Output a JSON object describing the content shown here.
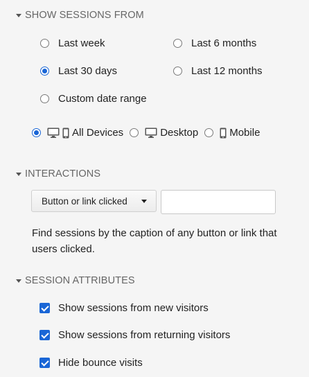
{
  "sessions_section": {
    "title": "SHOW SESSIONS FROM",
    "options": [
      {
        "label": "Last week",
        "checked": false
      },
      {
        "label": "Last 6 months",
        "checked": false
      },
      {
        "label": "Last 30 days",
        "checked": true
      },
      {
        "label": "Last 12 months",
        "checked": false
      },
      {
        "label": "Custom date range",
        "checked": false
      }
    ],
    "devices": [
      {
        "label": "All Devices",
        "checked": true
      },
      {
        "label": "Desktop",
        "checked": false
      },
      {
        "label": "Mobile",
        "checked": false
      }
    ]
  },
  "interactions_section": {
    "title": "INTERACTIONS",
    "dropdown_value": "Button or link clicked",
    "caption_input_value": "",
    "help_text": "Find sessions by the caption of any button or link that users clicked."
  },
  "attributes_section": {
    "title": "SESSION ATTRIBUTES",
    "checkboxes": [
      {
        "label": "Show sessions from new visitors",
        "checked": true
      },
      {
        "label": "Show sessions from returning visitors",
        "checked": true
      },
      {
        "label": "Hide bounce visits",
        "checked": true
      }
    ]
  },
  "colors": {
    "accent": "#1a66d6",
    "section_header": "#666666",
    "background": "#f5f5f5"
  }
}
